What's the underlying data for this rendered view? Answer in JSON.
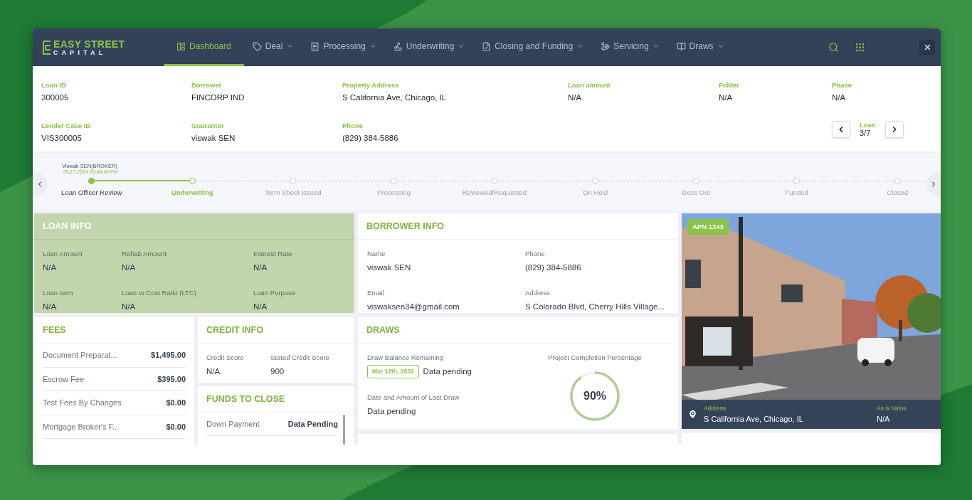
{
  "brand": {
    "line1": "EASY STREET",
    "line2": "CAPITAL"
  },
  "nav": [
    {
      "label": "Dashboard",
      "selected": true,
      "dropdown": false
    },
    {
      "label": "Deal",
      "selected": false,
      "dropdown": true
    },
    {
      "label": "Processing",
      "selected": false,
      "dropdown": true
    },
    {
      "label": "Underwriting",
      "selected": false,
      "dropdown": true
    },
    {
      "label": "Closing and Funding",
      "selected": false,
      "dropdown": true
    },
    {
      "label": "Servicing",
      "selected": false,
      "dropdown": true
    },
    {
      "label": "Draws",
      "selected": false,
      "dropdown": true
    }
  ],
  "summary_rows": [
    [
      {
        "label": "Loan ID",
        "value": "300005"
      },
      {
        "label": "Borrower",
        "value": "FINCORP IND"
      },
      {
        "label": "Property Address",
        "value": "S California Ave, Chicago, IL"
      },
      {
        "label": "Loan amount",
        "value": "N/A"
      },
      {
        "label": "Folder",
        "value": "N/A"
      },
      {
        "label": "Phase",
        "value": "N/A"
      }
    ],
    [
      {
        "label": "Lender Case ID",
        "value": "VIS300005"
      },
      {
        "label": "Guarantor",
        "value": "viswak SEN"
      },
      {
        "label": "Phone",
        "value": "(829) 384-5886"
      }
    ]
  ],
  "loan_pager": {
    "label": "Loan",
    "value": "3/7"
  },
  "timeline": {
    "actor": "Viswak SEN(BROKER)",
    "timestamp": "05-17-2024 05:48:40 PM",
    "steps": [
      {
        "label": "Loan Officer Review",
        "completed": true,
        "selected": false
      },
      {
        "label": "Underwriting",
        "completed": false,
        "selected": true
      },
      {
        "label": "Term Sheet Issued",
        "completed": false,
        "selected": false
      },
      {
        "label": "Processing",
        "completed": false,
        "selected": false
      },
      {
        "label": "Reviewed/Requested",
        "completed": false,
        "selected": false
      },
      {
        "label": "On Hold",
        "completed": false,
        "selected": false
      },
      {
        "label": "Docs Out",
        "completed": false,
        "selected": false
      },
      {
        "label": "Funded",
        "completed": false,
        "selected": false
      },
      {
        "label": "Closed",
        "completed": false,
        "selected": false
      }
    ]
  },
  "loan_info": {
    "title": "LOAN INFO",
    "fields": [
      {
        "label": "Loan Amount",
        "value": "N/A"
      },
      {
        "label": "Rehab Amount",
        "value": "N/A"
      },
      {
        "label": "Interest Rate",
        "value": "N/A"
      },
      {
        "label": "Loan term",
        "value": "N/A"
      },
      {
        "label": "Loan to Cost Ratio (LTC)",
        "value": "N/A"
      },
      {
        "label": "Loan Purpose",
        "value": "N/A"
      }
    ]
  },
  "borrower_info": {
    "title": "BORROWER INFO",
    "fields": [
      {
        "label": "Name",
        "value": "viswak SEN"
      },
      {
        "label": "Phone",
        "value": "(829) 384-5886"
      },
      {
        "label": "Email",
        "value": "viswaksen34@gmail.com"
      },
      {
        "label": "Address",
        "value": "S Colorado Blvd, Cherry Hills Village..."
      }
    ]
  },
  "fees": {
    "title": "FEES",
    "rows": [
      {
        "label": "Document Preparat...",
        "amount": "$1,495.00"
      },
      {
        "label": "Escrow Fee",
        "amount": "$395.00"
      },
      {
        "label": "Test Fees By Changes",
        "amount": "$0.00"
      },
      {
        "label": "Mortgage Broker's F...",
        "amount": "$0.00"
      }
    ]
  },
  "credit_info": {
    "title": "CREDIT INFO",
    "fields": [
      {
        "label": "Credit Score",
        "value": "N/A"
      },
      {
        "label": "Stated Credit Score",
        "value": "900"
      }
    ]
  },
  "funds_to_close": {
    "title": "FUNDS TO CLOSE",
    "rows": [
      {
        "label": "Down Payment",
        "value": "Data Pending"
      }
    ]
  },
  "draws": {
    "title": "DRAWS",
    "balance_label": "Draw Balance Remaining",
    "date_tag": "Mar 12th, 2024",
    "balance_value": "Data pending",
    "last_label": "Date and Amount of Last Draw",
    "last_value": "Data pending",
    "completion_label": "Project Completion Percentage",
    "completion_text": "90%",
    "level": 0.9
  },
  "property": {
    "badge": "APN 1243",
    "address_label": "Address",
    "address": "S California Ave, Chicago, IL",
    "value_label": "As is Value",
    "value": "N/A"
  }
}
